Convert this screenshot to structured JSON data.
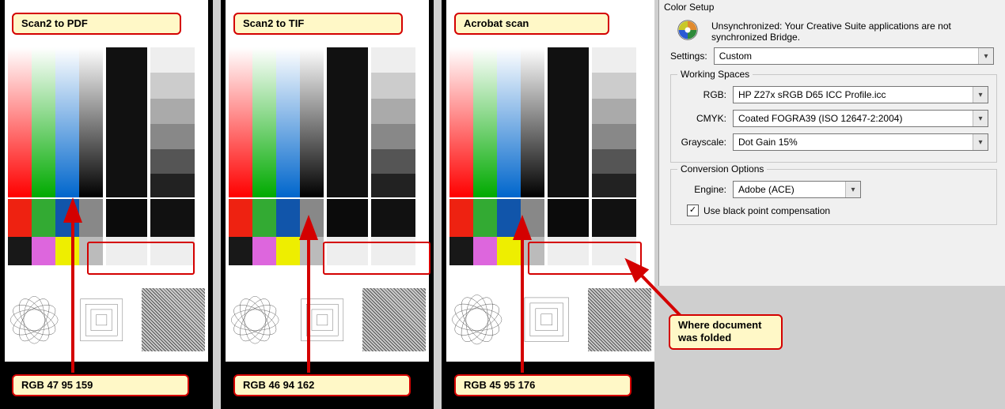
{
  "scans": [
    {
      "title": "Scan2 to PDF",
      "rgb_label": "RGB 47 95 159"
    },
    {
      "title": "Scan2 to TIF",
      "rgb_label": "RGB 46 94 162"
    },
    {
      "title": "Acrobat scan",
      "rgb_label": "RGB 45 95 176"
    }
  ],
  "fold_note": "Where document\nwas folded",
  "panel": {
    "title": "Color Setup",
    "warning": "Unsynchronized: Your Creative Suite applications are not synchronized Bridge.",
    "settings_label": "Settings:",
    "settings_value": "Custom",
    "working_spaces": {
      "legend": "Working Spaces",
      "rgb_label": "RGB:",
      "rgb_value": "HP Z27x sRGB D65 ICC Profile.icc",
      "cmyk_label": "CMYK:",
      "cmyk_value": "Coated FOGRA39 (ISO 12647-2:2004)",
      "gray_label": "Grayscale:",
      "gray_value": "Dot Gain 15%"
    },
    "conversion": {
      "legend": "Conversion Options",
      "engine_label": "Engine:",
      "engine_value": "Adobe (ACE)",
      "bpc_label": "Use black point compensation",
      "bpc_checked": true
    }
  },
  "colors": {
    "accent_red": "#d40000",
    "note_bg": "#fff8c7"
  }
}
